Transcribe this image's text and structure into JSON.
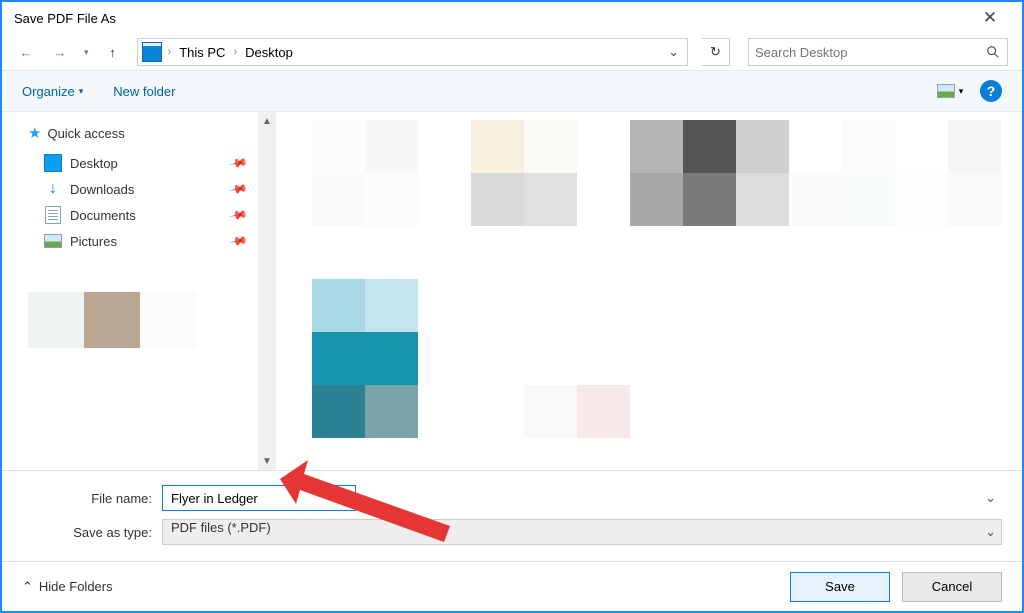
{
  "title": "Save PDF File As",
  "breadcrumb": {
    "root": "This PC",
    "current": "Desktop"
  },
  "search": {
    "placeholder": "Search Desktop"
  },
  "toolbar": {
    "organize": "Organize",
    "newfolder": "New folder"
  },
  "sidebar": {
    "quickaccess": "Quick access",
    "items": [
      {
        "label": "Desktop"
      },
      {
        "label": "Downloads"
      },
      {
        "label": "Documents"
      },
      {
        "label": "Pictures"
      }
    ]
  },
  "form": {
    "filename_label": "File name:",
    "filename_value": "Flyer in Ledger",
    "type_label": "Save as type:",
    "type_value": "PDF files (*.PDF)"
  },
  "footer": {
    "hide": "Hide Folders",
    "save": "Save",
    "cancel": "Cancel"
  }
}
